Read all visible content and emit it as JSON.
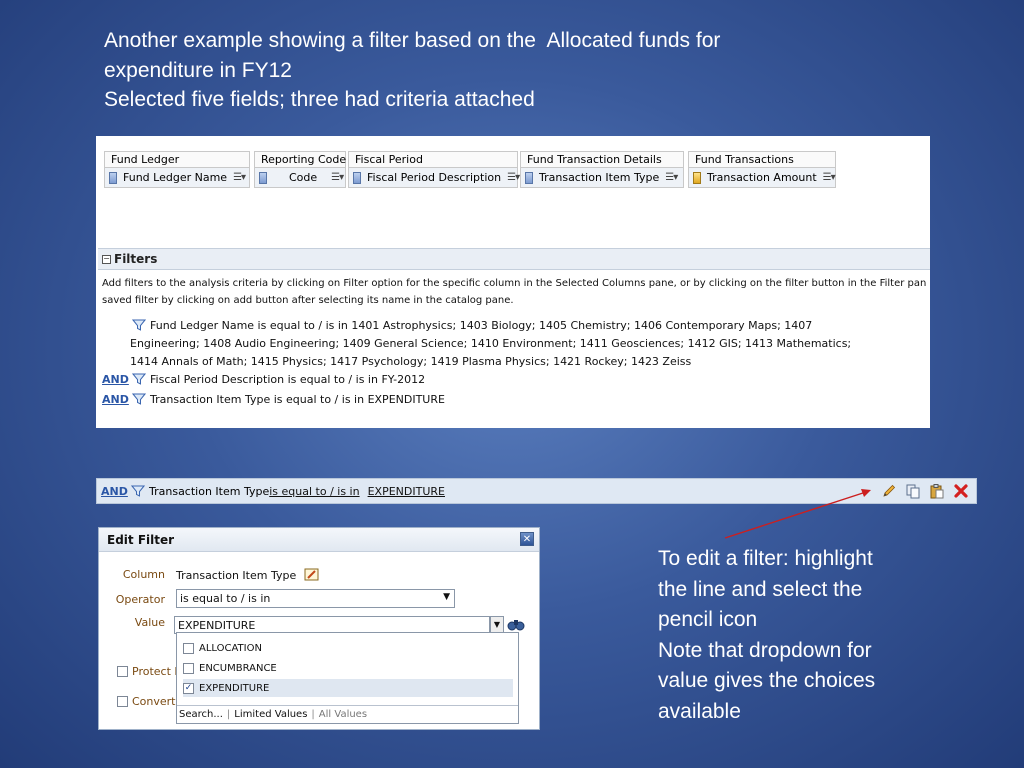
{
  "slide": {
    "heading_lines": [
      "Another example showing a filter based on the  Allocated funds for",
      "expenditure in FY12",
      "Selected five fields; three had criteria attached"
    ],
    "note_lines": [
      "To edit a filter: highlight",
      "the line and select the",
      "pencil icon",
      "Note that dropdown for",
      "value gives the choices",
      "available"
    ]
  },
  "criteria": {
    "columns": [
      {
        "group": "Fund Ledger",
        "field": "Fund Ledger Name",
        "kind": "attribute"
      },
      {
        "group": "Reporting Code",
        "field": "Code",
        "kind": "attribute"
      },
      {
        "group": "Fiscal Period",
        "field": "Fiscal Period Description",
        "kind": "attribute"
      },
      {
        "group": "Fund Transaction Details",
        "field": "Transaction Item Type",
        "kind": "attribute"
      },
      {
        "group": "Fund Transactions",
        "field": "Transaction Amount",
        "kind": "measure"
      }
    ],
    "filters_title": "Filters",
    "instructions": [
      "Add filters to the analysis criteria by clicking on Filter option for the specific column in the Selected Columns pane, or by clicking on the filter button in the Filter pan",
      "saved filter by clicking on add button after selecting its name in the catalog pane."
    ],
    "filter1_lines": [
      "Fund Ledger Name is equal to / is in  1401 Astrophysics; 1403 Biology; 1405 Chemistry; 1406 Contemporary Maps; 1407",
      "Engineering; 1408 Audio Engineering; 1409 General Science; 1410 Environment; 1411 Geosciences; 1412 GIS; 1413 Mathematics;",
      "1414 Annals of Math; 1415 Physics; 1417 Psychology; 1419 Plasma Physics; 1421 Rockey; 1423 Zeiss"
    ],
    "and_label": "AND",
    "filter2": "Fiscal Period Description is equal to / is in  FY-2012",
    "filter3": "Transaction Item Type is equal to / is in  EXPENDITURE"
  },
  "strip": {
    "and_label": "AND",
    "column": "Transaction Item Type",
    "operator": " is equal to / is in",
    "value": "EXPENDITURE"
  },
  "dialog": {
    "title": "Edit Filter",
    "column_label": "Column",
    "column_value": "Transaction Item Type",
    "operator_label": "Operator",
    "operator_value": "is equal to / is in",
    "value_label": "Value",
    "value_value": "EXPENDITURE",
    "options": [
      {
        "label": "ALLOCATION",
        "checked": false
      },
      {
        "label": "ENCUMBRANCE",
        "checked": false
      },
      {
        "label": "EXPENDITURE",
        "checked": true
      }
    ],
    "search_label": "Search...",
    "limited_values": "Limited Values",
    "all_values": "All Values",
    "protect_label": "Protect F",
    "convert_label": "Convert"
  },
  "colors": {
    "link": "#2a56a6",
    "arrow": "#cc1f1f",
    "label_brown": "#7a4a12"
  }
}
